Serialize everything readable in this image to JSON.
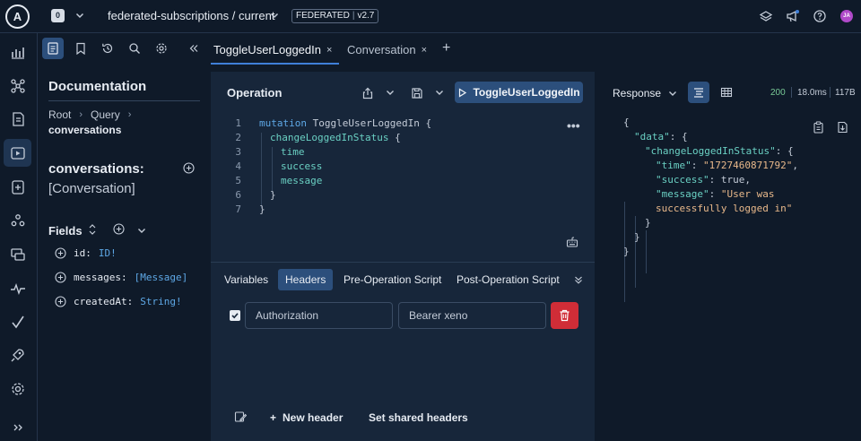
{
  "topbar": {
    "logo_letter": "A",
    "org_badge": "0",
    "graph_name": "federated-subscriptions / current",
    "variant_badge_left": "FEDERATED",
    "variant_badge_right": "v2.7",
    "avatar_initials": "JA",
    "icons": [
      "layers-icon",
      "megaphone-icon",
      "help-icon"
    ]
  },
  "rail": {
    "icons": [
      "dashboard-icon",
      "schema-icon",
      "changelog-icon",
      "explorer-icon",
      "checks-icon",
      "clients-icon",
      "launches-icon",
      "insights-icon",
      "lint-icon",
      "deploy-icon",
      "settings-icon",
      "expand-icon"
    ]
  },
  "docs": {
    "title": "Documentation",
    "breadcrumb": [
      "Root",
      "Query"
    ],
    "current": "conversations",
    "field_name": "conversations:",
    "field_type": "[Conversation]",
    "fields_heading": "Fields",
    "fields": [
      {
        "name": "id:",
        "type": "ID!"
      },
      {
        "name": "messages:",
        "type": "[Message]"
      },
      {
        "name": "createdAt:",
        "type": "String!"
      }
    ]
  },
  "tabs": [
    {
      "label": "ToggleUserLoggedIn",
      "close": "×"
    },
    {
      "label": "Conversation",
      "close": "×"
    }
  ],
  "tab_add": "+",
  "operation": {
    "title": "Operation",
    "run_label": "ToggleUserLoggedIn",
    "more": "•••",
    "lines": [
      {
        "n": "1",
        "parts": [
          {
            "t": "mutation ",
            "c": "kw"
          },
          {
            "t": "ToggleUserLoggedIn ",
            "c": "op-name"
          },
          {
            "t": "{",
            "c": "brace"
          }
        ],
        "indent": 0
      },
      {
        "n": "2",
        "parts": [
          {
            "t": "changeLoggedInStatus ",
            "c": "fld"
          },
          {
            "t": "{",
            "c": "brace"
          }
        ],
        "indent": 1
      },
      {
        "n": "3",
        "parts": [
          {
            "t": "time",
            "c": "fld"
          }
        ],
        "indent": 2
      },
      {
        "n": "4",
        "parts": [
          {
            "t": "success",
            "c": "fld"
          }
        ],
        "indent": 2
      },
      {
        "n": "5",
        "parts": [
          {
            "t": "message",
            "c": "fld"
          }
        ],
        "indent": 2
      },
      {
        "n": "6",
        "parts": [
          {
            "t": "}",
            "c": "brace"
          }
        ],
        "indent": 1
      },
      {
        "n": "7",
        "parts": [
          {
            "t": "}",
            "c": "brace"
          }
        ],
        "indent": 0
      }
    ]
  },
  "lower_tabs": [
    "Variables",
    "Headers",
    "Pre-Operation Script",
    "Post-Operation Script"
  ],
  "headers": {
    "checked": true,
    "key": "Authorization",
    "value": "Bearer xeno"
  },
  "bottom": {
    "new_header": "New header",
    "new_header_plus": "+",
    "shared_headers": "Set shared headers"
  },
  "response": {
    "label": "Response",
    "status": "200",
    "time": "18.0ms",
    "size": "117B",
    "json_lines": [
      {
        "indent": 0,
        "parts": [
          {
            "t": "{",
            "c": ""
          }
        ]
      },
      {
        "indent": 1,
        "parts": [
          {
            "t": "\"data\"",
            "c": "rkey"
          },
          {
            "t": ": {",
            "c": ""
          }
        ]
      },
      {
        "indent": 2,
        "parts": [
          {
            "t": "\"changeLoggedInStatus\"",
            "c": "rkey"
          },
          {
            "t": ": {",
            "c": ""
          }
        ]
      },
      {
        "indent": 3,
        "parts": [
          {
            "t": "\"time\"",
            "c": "rkey"
          },
          {
            "t": ": ",
            "c": ""
          },
          {
            "t": "\"1727460871792\"",
            "c": "rstr"
          },
          {
            "t": ",",
            "c": ""
          }
        ]
      },
      {
        "indent": 3,
        "parts": [
          {
            "t": "\"success\"",
            "c": "rkey"
          },
          {
            "t": ": true,",
            "c": ""
          }
        ]
      },
      {
        "indent": 3,
        "parts": [
          {
            "t": "\"message\"",
            "c": "rkey"
          },
          {
            "t": ": ",
            "c": ""
          },
          {
            "t": "\"User was",
            "c": "rstr"
          }
        ]
      },
      {
        "indent": 3,
        "parts": [
          {
            "t": "successfully logged in\"",
            "c": "rstr"
          }
        ]
      },
      {
        "indent": 2,
        "parts": [
          {
            "t": "}",
            "c": ""
          }
        ]
      },
      {
        "indent": 1,
        "parts": [
          {
            "t": "}",
            "c": ""
          }
        ]
      },
      {
        "indent": 0,
        "parts": [
          {
            "t": "}",
            "c": ""
          }
        ]
      }
    ]
  },
  "colors": {
    "background": "#0f1a29",
    "panel": "#17263a",
    "accent": "#2c4f7c",
    "tab_underline": "#3f7fd9",
    "delete": "#d02d37",
    "status_ok": "#78c996"
  }
}
